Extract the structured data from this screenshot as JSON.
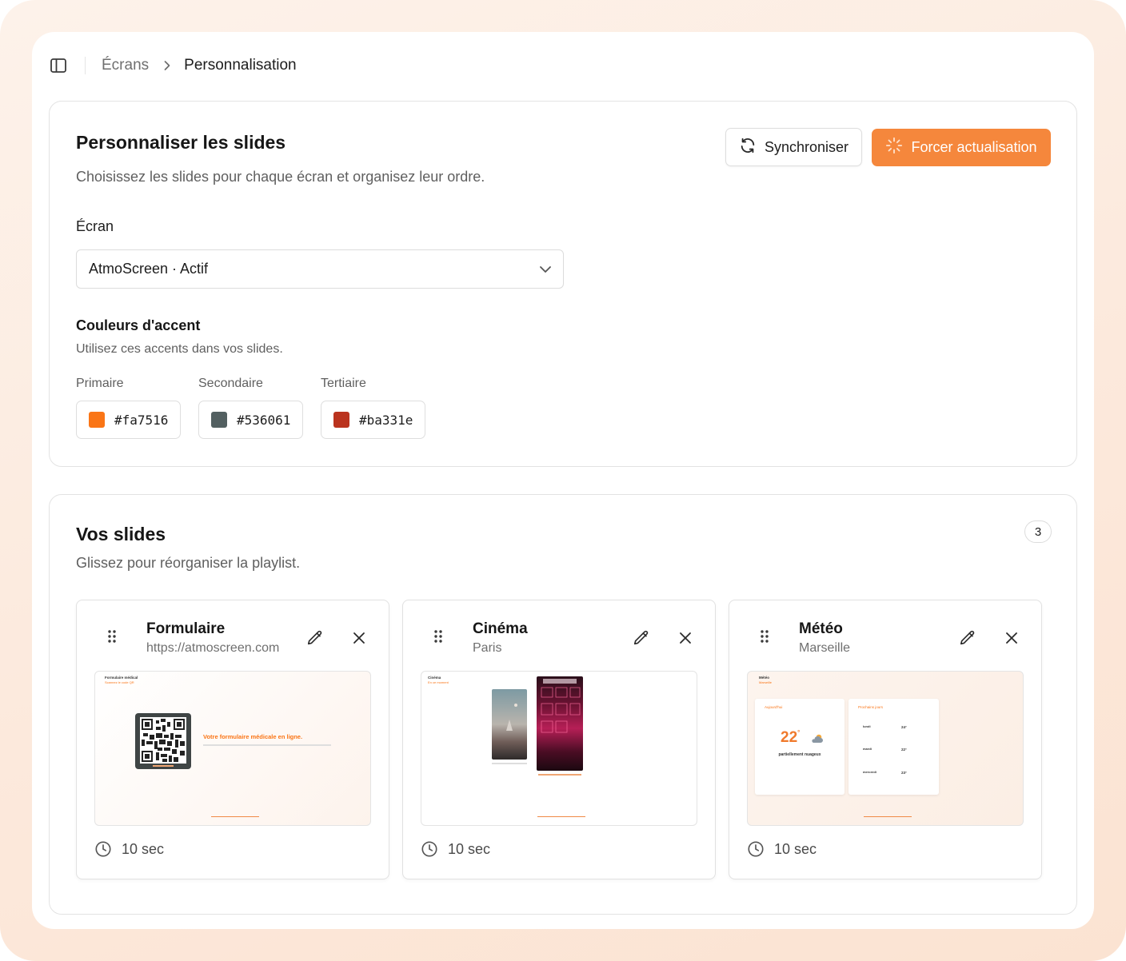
{
  "breadcrumb": {
    "parent": "Écrans",
    "current": "Personnalisation"
  },
  "customize": {
    "title": "Personnaliser les slides",
    "subtitle": "Choisissez les slides pour chaque écran et organisez leur ordre.",
    "sync_label": "Synchroniser",
    "force_label": "Forcer actualisation",
    "screen_label": "Écran",
    "screen_value": "AtmoScreen · Actif",
    "accent": {
      "title": "Couleurs d'accent",
      "subtitle": "Utilisez ces accents dans vos slides.",
      "colors": [
        {
          "label": "Primaire",
          "value": "#fa7516"
        },
        {
          "label": "Secondaire",
          "value": "#536061"
        },
        {
          "label": "Tertiaire",
          "value": "#ba331e"
        }
      ]
    }
  },
  "slides_section": {
    "title": "Vos slides",
    "subtitle": "Glissez pour réorganiser la playlist.",
    "count": "3",
    "slides": [
      {
        "title": "Formulaire",
        "subtitle": "https://atmoscreen.com",
        "duration": "10 sec",
        "preview": {
          "heading": "Formulaire médical",
          "tagline": "Scannez le code QR",
          "message": "Votre formulaire médicale en ligne."
        }
      },
      {
        "title": "Cinéma",
        "subtitle": "Paris",
        "duration": "10 sec",
        "preview": {
          "heading": "Cinéma",
          "tagline": "En ce moment"
        }
      },
      {
        "title": "Météo",
        "subtitle": "Marseille",
        "duration": "10 sec",
        "preview": {
          "heading": "Météo",
          "tagline": "Marseille",
          "today_label": "Aujourd'hui",
          "temp": "22",
          "unit": "°",
          "condition": "partiellement nuageux",
          "next_label": "Prochains jours",
          "days": [
            {
              "name": "lundi",
              "temp": "24°"
            },
            {
              "name": "mardi",
              "temp": "22°"
            },
            {
              "name": "mercredi",
              "temp": "23°"
            }
          ]
        }
      }
    ]
  },
  "colors": {
    "accent": "#f5873c",
    "brand_orange": "#fa7516"
  },
  "icons": [
    "sidebar-panel-icon",
    "chevron-right-icon",
    "refresh-icon",
    "sparkle-loader-icon",
    "chevron-down-icon",
    "drag-handle-icon",
    "pencil-icon",
    "close-icon",
    "clock-icon"
  ]
}
